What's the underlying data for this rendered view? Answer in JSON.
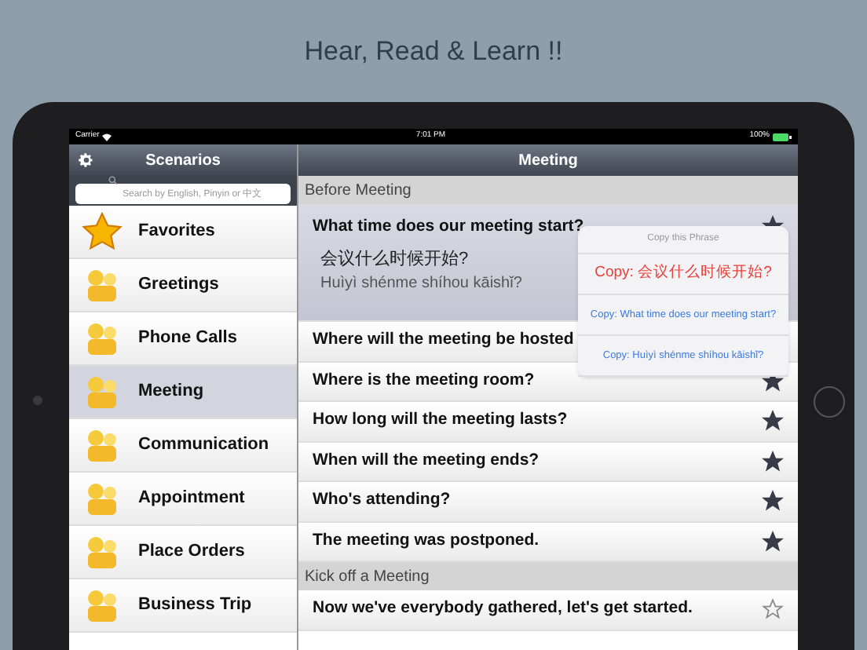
{
  "headline": "Hear, Read & Learn !!",
  "status_bar": {
    "carrier": "Carrier",
    "time": "7:01 PM",
    "battery": "100%"
  },
  "sidebar": {
    "title": "Scenarios",
    "search": {
      "placeholder": "Search by English, Pinyin or 中文"
    },
    "items": [
      {
        "label": "Favorites",
        "kind": "star",
        "selected": false
      },
      {
        "label": "Greetings",
        "kind": "scenario",
        "selected": false
      },
      {
        "label": "Phone Calls",
        "kind": "scenario",
        "selected": false
      },
      {
        "label": "Meeting",
        "kind": "scenario",
        "selected": true
      },
      {
        "label": "Communication",
        "kind": "scenario",
        "selected": false
      },
      {
        "label": "Appointment",
        "kind": "scenario",
        "selected": false
      },
      {
        "label": "Place Orders",
        "kind": "scenario",
        "selected": false
      },
      {
        "label": "Business Trip",
        "kind": "scenario",
        "selected": false
      }
    ]
  },
  "content": {
    "title": "Meeting",
    "sections": [
      {
        "header": "Before Meeting",
        "phrases": [
          {
            "english": "What time does our meeting start?",
            "chinese": "会议什么时候开始?",
            "pinyin": "Huìyì shénme shíhou kāishǐ?",
            "expanded": true,
            "starred": true
          },
          {
            "english": "Where will the meeting be hosted",
            "expanded": false
          },
          {
            "english": "Where is the meeting room?",
            "expanded": false,
            "starred": true
          },
          {
            "english": "How long will the meeting lasts?",
            "expanded": false,
            "starred": true
          },
          {
            "english": "When will the meeting ends?",
            "expanded": false,
            "starred": true
          },
          {
            "english": "Who's attending?",
            "expanded": false,
            "starred": true
          },
          {
            "english": "The meeting was postponed.",
            "expanded": false,
            "starred": true
          }
        ]
      },
      {
        "header": "Kick off a Meeting",
        "phrases": [
          {
            "english": "Now we've everybody gathered, let's get started.",
            "expanded": false,
            "starred": false
          }
        ]
      }
    ]
  },
  "popover": {
    "title": "Copy this Phrase",
    "actions": [
      {
        "label": "Copy: 会议什么时候开始?",
        "kind": "primary"
      },
      {
        "label": "Copy: What time does our meeting start?",
        "kind": "normal"
      },
      {
        "label": "Copy: Huìyì shénme shíhou kāishǐ?",
        "kind": "normal"
      }
    ]
  }
}
